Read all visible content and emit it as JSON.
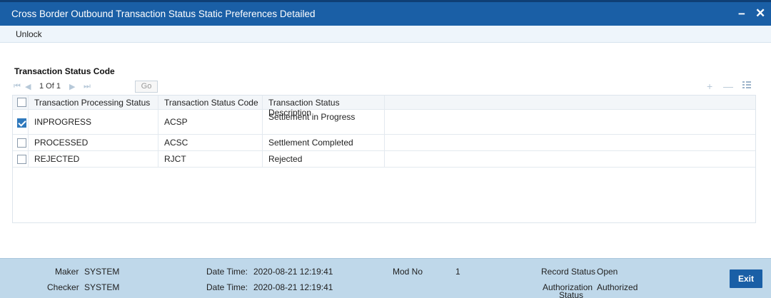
{
  "window": {
    "title": "Cross Border Outbound Transaction Status Static Preferences Detailed",
    "minimize_label": "−",
    "close_label": "✕"
  },
  "toolbar": {
    "unlock_label": "Unlock"
  },
  "section": {
    "title": "Transaction Status Code"
  },
  "pager": {
    "page_info": "1 Of 1",
    "go_label": "Go",
    "icons": [
      "first-page-icon",
      "previous-page-icon",
      "next-page-icon",
      "last-page-icon",
      "add-row-icon",
      "delete-row-icon",
      "columns-icon"
    ]
  },
  "table": {
    "columns": [
      "Transaction Processing Status",
      "Transaction Status Code",
      "Transaction Status Description"
    ],
    "rows": [
      {
        "checked": true,
        "processing_status": "INPROGRESS",
        "code": "ACSP",
        "description": "Settlement in Progress"
      },
      {
        "checked": false,
        "processing_status": "PROCESSED",
        "code": "ACSC",
        "description": "Settlement Completed"
      },
      {
        "checked": false,
        "processing_status": "REJECTED",
        "code": "RJCT",
        "description": "Rejected"
      }
    ]
  },
  "footer": {
    "maker_label": "Maker",
    "maker_value": "SYSTEM",
    "checker_label": "Checker",
    "checker_value": "SYSTEM",
    "maker_datetime_label": "Date Time:",
    "maker_datetime_value": "2020-08-21 12:19:41",
    "checker_datetime_label": "Date Time:",
    "checker_datetime_value": "2020-08-21 12:19:41",
    "mod_no_label": "Mod No",
    "mod_no_value": "1",
    "record_status_label": "Record Status",
    "record_status_value": "Open",
    "auth_status_label_1": "Authorization",
    "auth_status_label_2": "Status",
    "auth_status_value": "Authorized",
    "exit_label": "Exit"
  },
  "colors": {
    "titlebar": "#1a5fa6",
    "footer": "#bfd8ea",
    "checkbox_checked": "#2f79bd"
  }
}
